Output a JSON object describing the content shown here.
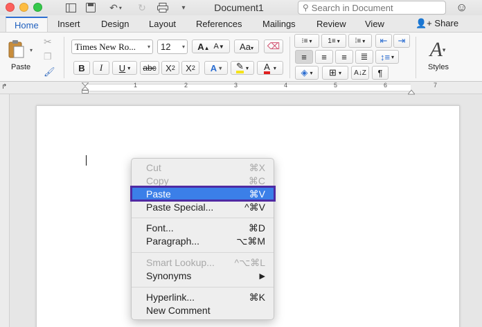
{
  "window": {
    "title": "Document1"
  },
  "search": {
    "placeholder": "Search in Document"
  },
  "tabs": [
    "Home",
    "Insert",
    "Design",
    "Layout",
    "References",
    "Mailings",
    "Review",
    "View"
  ],
  "share_label": "Share",
  "ribbon": {
    "paste_label": "Paste",
    "font_name": "Times New Ro...",
    "font_size": "12",
    "styles_label": "Styles",
    "bold": "B",
    "italic": "I",
    "underline": "U",
    "strike": "abc",
    "subscript": "X",
    "superscript": "X",
    "sub_mark": "2",
    "sup_mark": "2",
    "grow": "A",
    "shrink": "A",
    "pilcrow": "¶"
  },
  "ruler_numbers": [
    "1",
    "2",
    "3",
    "4",
    "5",
    "6",
    "7"
  ],
  "context_menu": {
    "items": [
      {
        "label": "Cut",
        "shortcut": "⌘X",
        "state": "disabled"
      },
      {
        "label": "Copy",
        "shortcut": "⌘C",
        "state": "disabled"
      },
      {
        "label": "Paste",
        "shortcut": "⌘V",
        "state": "highlighted"
      },
      {
        "label": "Paste Special...",
        "shortcut": "^⌘V",
        "state": "enabled"
      },
      {
        "label": "Font...",
        "shortcut": "⌘D",
        "state": "enabled"
      },
      {
        "label": "Paragraph...",
        "shortcut": "⌥⌘M",
        "state": "enabled"
      },
      {
        "label": "Smart Lookup...",
        "shortcut": "^⌥⌘L",
        "state": "disabled"
      },
      {
        "label": "Synonyms",
        "shortcut": "▶",
        "state": "enabled"
      },
      {
        "label": "Hyperlink...",
        "shortcut": "⌘K",
        "state": "enabled"
      },
      {
        "label": "New Comment",
        "shortcut": "",
        "state": "enabled"
      }
    ]
  },
  "colors": {
    "accent": "#3b7fe8",
    "highlight_outline": "#4f2aa3",
    "font_color": "#e02020",
    "highlight_color": "#f5e31b"
  }
}
